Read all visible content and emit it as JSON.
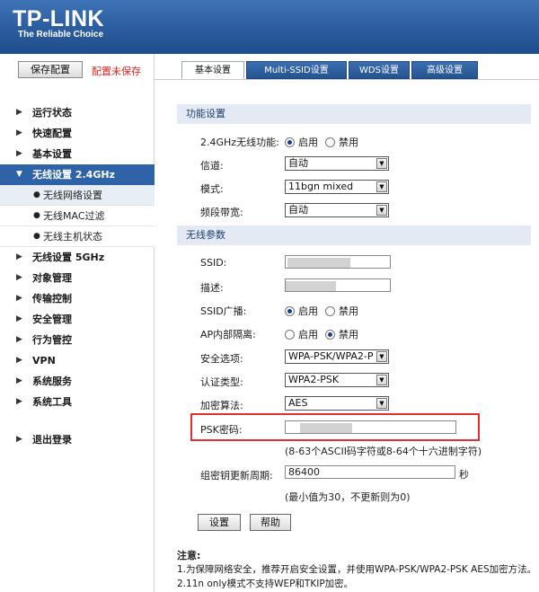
{
  "header": {
    "logo": "TP-LINK",
    "tagline": "The Reliable Choice"
  },
  "sidebar": {
    "save_label": "保存配置",
    "unsaved_label": "配置未保存",
    "menu": [
      {
        "label": "运行状态",
        "active": false
      },
      {
        "label": "快速配置",
        "active": false
      },
      {
        "label": "基本设置",
        "active": false
      },
      {
        "label": "无线设置 2.4GHz",
        "active": true
      },
      {
        "label": "无线网络设置",
        "sub": true,
        "selected": true
      },
      {
        "label": "无线MAC过滤",
        "sub": true
      },
      {
        "label": "无线主机状态",
        "sub": true
      },
      {
        "label": "无线设置 5GHz"
      },
      {
        "label": "对象管理"
      },
      {
        "label": "传输控制"
      },
      {
        "label": "安全管理"
      },
      {
        "label": "行为管控"
      },
      {
        "label": "VPN"
      },
      {
        "label": "系统服务"
      },
      {
        "label": "系统工具"
      },
      {
        "label": "退出登录"
      }
    ]
  },
  "tabs": [
    {
      "label": "基本设置",
      "active": true
    },
    {
      "label": "Multi-SSID设置"
    },
    {
      "label": "WDS设置"
    },
    {
      "label": "高级设置"
    }
  ],
  "function_section": {
    "title": "功能设置",
    "wireless_label": "2.4GHz无线功能:",
    "enable": "启用",
    "disable": "禁用",
    "wireless_value": "启用",
    "channel_label": "信道:",
    "channel_value": "自动",
    "mode_label": "模式:",
    "mode_value": "11bgn mixed",
    "bandwidth_label": "频段带宽:",
    "bandwidth_value": "自动"
  },
  "wireless_section": {
    "title": "无线参数",
    "ssid_label": "SSID:",
    "desc_label": "描述:",
    "broadcast_label": "SSID广播:",
    "broadcast_value": "启用",
    "isolation_label": "AP内部隔离:",
    "isolation_value": "禁用",
    "security_label": "安全选项:",
    "security_value": "WPA-PSK/WPA2-P",
    "auth_label": "认证类型:",
    "auth_value": "WPA2-PSK",
    "cipher_label": "加密算法:",
    "cipher_value": "AES",
    "psk_label": "PSK密码:",
    "psk_hint": "(8-63个ASCII码字符或8-64个十六进制字符)",
    "gk_label": "组密钥更新周期:",
    "gk_value": "86400",
    "gk_unit": "秒",
    "gk_hint": "(最小值为30，不更新则为0)"
  },
  "buttons": {
    "set": "设置",
    "help": "帮助"
  },
  "notes": {
    "title": "注意:",
    "line1": "1.为保障网络安全，推荐开启安全设置，并使用WPA-PSK/WPA2-PSK AES加密方法。",
    "line2": "2.11n only模式不支持WEP和TKIP加密。"
  },
  "colors": {
    "header": "#2a5c9e",
    "active_menu": "#2f63a8",
    "unsaved": "#e02020",
    "highlight": "#e03030"
  }
}
